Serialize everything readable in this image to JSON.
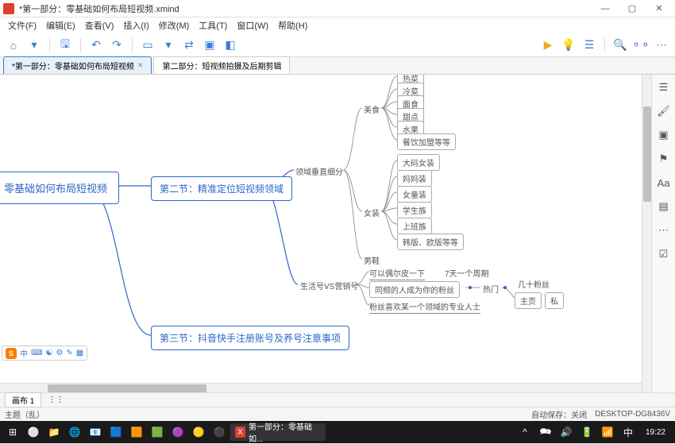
{
  "window": {
    "title": "*第一部分：零基础如何布局短视频.xmind",
    "min": "—",
    "max": "▢",
    "close": "✕"
  },
  "menu": [
    "文件(F)",
    "编辑(E)",
    "查看(V)",
    "插入(I)",
    "修改(M)",
    "工具(T)",
    "窗口(W)",
    "帮助(H)"
  ],
  "tabs": [
    {
      "label": "*第一部分：零基础如何布局短视频",
      "active": true
    },
    {
      "label": "第二部分：短视频拍摄及后期剪辑",
      "active": false
    }
  ],
  "mindmap": {
    "root": "零基础如何布局短视频",
    "section2": "第二节：精准定位短视频领域",
    "section3": "第三节：抖音快手注册账号及养号注意事项",
    "branch_a": "领域垂直细分",
    "branch_b": "生活号VS营销号",
    "cat_food": "美食",
    "food_items": [
      "热菜",
      "冷菜",
      "面食",
      "甜点",
      "水果",
      "餐饮加盟等等"
    ],
    "cat_women": "女装",
    "women_items": [
      "大码女装",
      "妈妈装",
      "女童装",
      "学生族",
      "上班族",
      "韩版、欧版等等"
    ],
    "cat_shoes": "男鞋",
    "tip1": "可以偶尔皮一下",
    "tip1b": "7天一个周期",
    "tip2": "同频的人成为你的粉丝",
    "tip2_tag": "热门",
    "tip2_tag2": "几十粉丝",
    "tip2_btn1": "主页",
    "tip2_btn2": "私",
    "tip3": "粉丝喜欢某一个领域的专业人士"
  },
  "ime": {
    "lang": "中",
    "icons": [
      "⌨",
      "☯",
      "⚙",
      "✎",
      "▦"
    ]
  },
  "sheet": {
    "tab": "画布 1",
    "extra": "⋮⋮"
  },
  "status": {
    "left": "主题（乱）",
    "right_save": "自动保存：关闭",
    "right_host": "DESKTOP-DG8436V"
  },
  "taskbar": {
    "apps_icons": [
      "⊞",
      "⚪",
      "📁",
      "🌐",
      "📧",
      "🟦",
      "🟧",
      "🟩",
      "🟣",
      "🟡",
      "⚫"
    ],
    "active_app_icon": "X",
    "active_app": "第一部分：零基础如...",
    "tray": [
      "^",
      "🗪",
      "🔊",
      "🔋",
      "📶",
      "中"
    ],
    "clock": "19:22"
  }
}
